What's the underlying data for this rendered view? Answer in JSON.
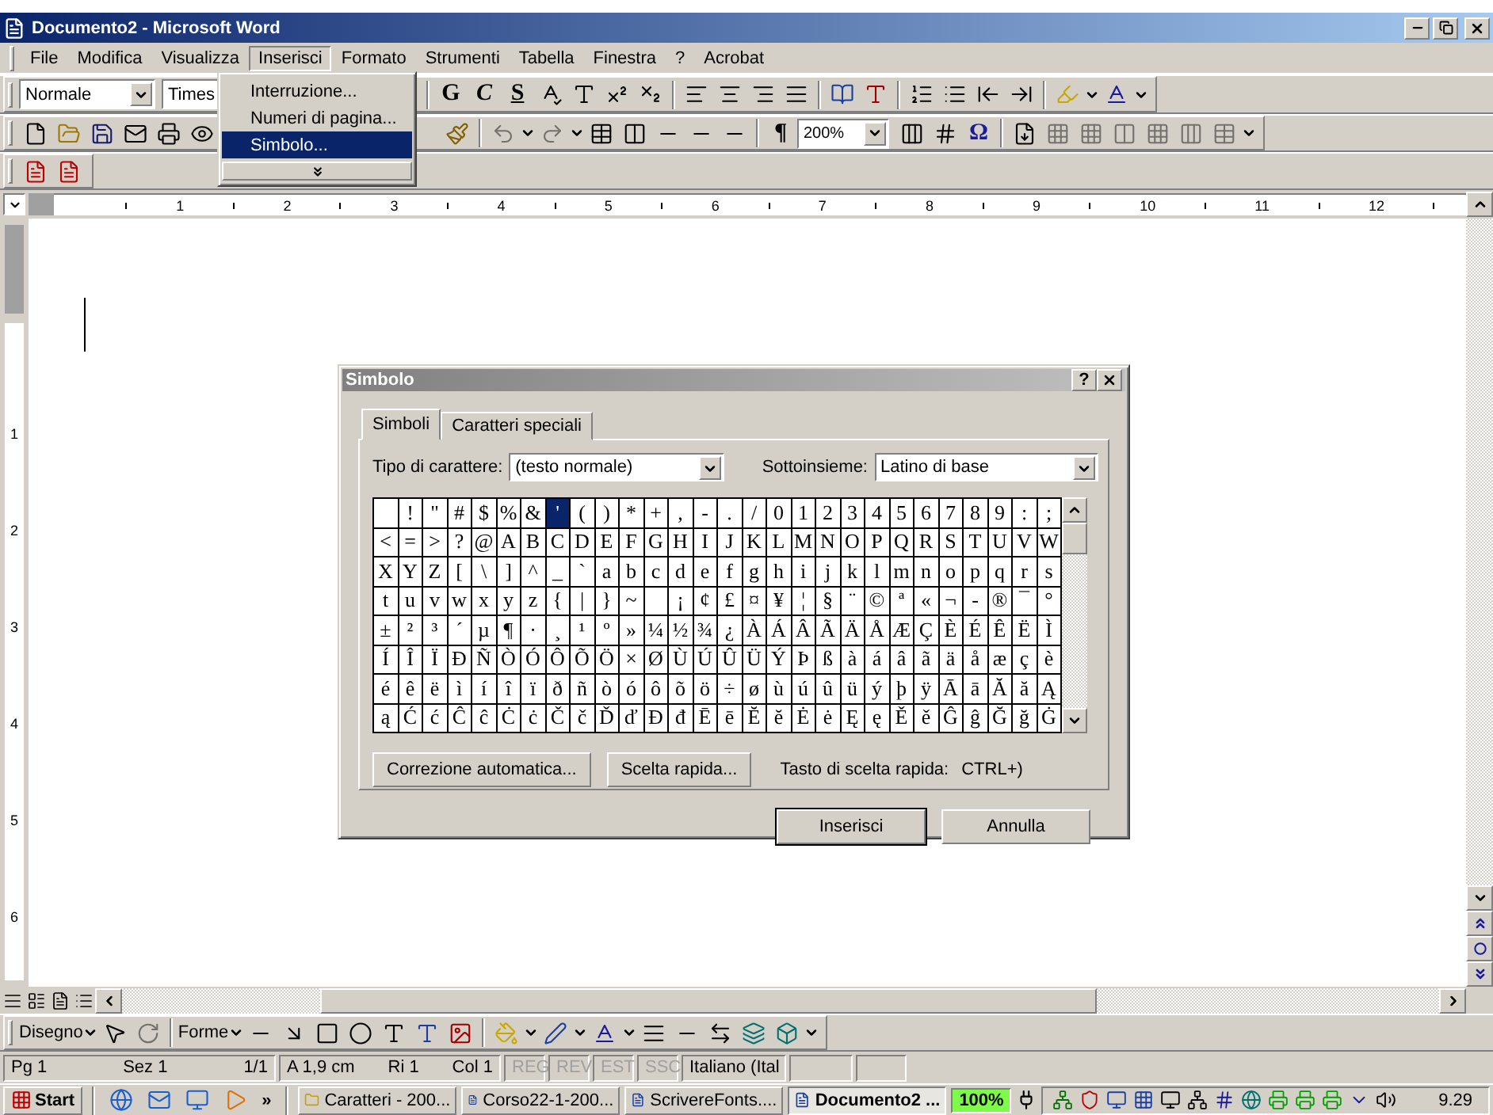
{
  "window": {
    "title": "Documento2 - Microsoft Word"
  },
  "menu": [
    {
      "label": "File",
      "selected": false
    },
    {
      "label": "Modifica",
      "selected": false
    },
    {
      "label": "Visualizza",
      "selected": false
    },
    {
      "label": "Inserisci",
      "selected": true
    },
    {
      "label": "Formato",
      "selected": false
    },
    {
      "label": "Strumenti",
      "selected": false
    },
    {
      "label": "Tabella",
      "selected": false
    },
    {
      "label": "Finestra",
      "selected": false
    },
    {
      "label": "?",
      "selected": false
    },
    {
      "label": "Acrobat",
      "selected": false
    }
  ],
  "insert_menu": {
    "items": [
      {
        "label": "Interruzione...",
        "selected": false
      },
      {
        "label": "Numeri di pagina...",
        "selected": false
      },
      {
        "label": "Simbolo...",
        "selected": true
      }
    ]
  },
  "formatting_toolbar": {
    "style": "Normale",
    "font": "Times",
    "text_buttons": [
      "G",
      "C",
      "S"
    ]
  },
  "standard_toolbar": {
    "pilcrow": "¶",
    "zoom": "200%",
    "symbol": "Ω"
  },
  "ruler": {
    "horizontal": [
      "1",
      "2",
      "3",
      "4",
      "5",
      "6",
      "7",
      "8",
      "9",
      "10",
      "11",
      "12"
    ],
    "vertical": [
      "1",
      "2",
      "3",
      "4",
      "5",
      "6"
    ]
  },
  "dialog": {
    "title": "Simbolo",
    "help": "?",
    "tabs": [
      {
        "label": "Simboli",
        "selected": true
      },
      {
        "label": "Caratteri speciali",
        "selected": false
      }
    ],
    "font_label": "Tipo di carattere:",
    "font_value": "(testo normale)",
    "subset_label": "Sottoinsieme:",
    "subset_value": "Latino di base",
    "grid": [
      [
        {
          "selected": false
        },
        {
          "char": "!",
          "selected": false
        },
        {
          "char": "\"",
          "selected": false
        },
        {
          "char": "#",
          "selected": false
        },
        {
          "char": "$",
          "selected": false
        },
        {
          "char": "%",
          "selected": false
        },
        {
          "char": "&",
          "selected": false
        },
        {
          "char": "'",
          "selected": true
        },
        {
          "char": "(",
          "selected": false
        },
        {
          "char": ")",
          "selected": false
        },
        {
          "char": "*",
          "selected": false
        },
        {
          "char": "+",
          "selected": false
        },
        {
          "char": ",",
          "selected": false
        },
        {
          "char": "-",
          "selected": false
        },
        {
          "char": ".",
          "selected": false
        },
        {
          "char": "/",
          "selected": false
        },
        {
          "char": "0",
          "selected": false
        },
        {
          "char": "1",
          "selected": false
        },
        {
          "char": "2",
          "selected": false
        },
        {
          "char": "3",
          "selected": false
        },
        {
          "char": "4",
          "selected": false
        },
        {
          "char": "5",
          "selected": false
        },
        {
          "char": "6",
          "selected": false
        },
        {
          "char": "7",
          "selected": false
        },
        {
          "char": "8",
          "selected": false
        },
        {
          "char": "9",
          "selected": false
        },
        {
          "char": ":",
          "selected": false
        },
        {
          "char": ";",
          "selected": false
        }
      ],
      [
        {
          "char": "<",
          "selected": false
        },
        {
          "char": "=",
          "selected": false
        },
        {
          "char": ">",
          "selected": false
        },
        {
          "char": "?",
          "selected": false
        },
        {
          "char": "@",
          "selected": false
        },
        {
          "char": "A",
          "selected": false
        },
        {
          "char": "B",
          "selected": false
        },
        {
          "char": "C",
          "selected": false
        },
        {
          "char": "D",
          "selected": false
        },
        {
          "char": "E",
          "selected": false
        },
        {
          "char": "F",
          "selected": false
        },
        {
          "char": "G",
          "selected": false
        },
        {
          "char": "H",
          "selected": false
        },
        {
          "char": "I",
          "selected": false
        },
        {
          "char": "J",
          "selected": false
        },
        {
          "char": "K",
          "selected": false
        },
        {
          "char": "L",
          "selected": false
        },
        {
          "char": "M",
          "selected": false
        },
        {
          "char": "N",
          "selected": false
        },
        {
          "char": "O",
          "selected": false
        },
        {
          "char": "P",
          "selected": false
        },
        {
          "char": "Q",
          "selected": false
        },
        {
          "char": "R",
          "selected": false
        },
        {
          "char": "S",
          "selected": false
        },
        {
          "char": "T",
          "selected": false
        },
        {
          "char": "U",
          "selected": false
        },
        {
          "char": "V",
          "selected": false
        },
        {
          "char": "W",
          "selected": false
        }
      ],
      [
        {
          "char": "X",
          "selected": false
        },
        {
          "char": "Y",
          "selected": false
        },
        {
          "char": "Z",
          "selected": false
        },
        {
          "char": "[",
          "selected": false
        },
        {
          "char": "\\",
          "selected": false
        },
        {
          "char": "]",
          "selected": false
        },
        {
          "char": "^",
          "selected": false
        },
        {
          "char": "_",
          "selected": false
        },
        {
          "char": "`",
          "selected": false
        },
        {
          "char": "a",
          "selected": false
        },
        {
          "char": "b",
          "selected": false
        },
        {
          "char": "c",
          "selected": false
        },
        {
          "char": "d",
          "selected": false
        },
        {
          "char": "e",
          "selected": false
        },
        {
          "char": "f",
          "selected": false
        },
        {
          "char": "g",
          "selected": false
        },
        {
          "char": "h",
          "selected": false
        },
        {
          "char": "i",
          "selected": false
        },
        {
          "char": "j",
          "selected": false
        },
        {
          "char": "k",
          "selected": false
        },
        {
          "char": "l",
          "selected": false
        },
        {
          "char": "m",
          "selected": false
        },
        {
          "char": "n",
          "selected": false
        },
        {
          "char": "o",
          "selected": false
        },
        {
          "char": "p",
          "selected": false
        },
        {
          "char": "q",
          "selected": false
        },
        {
          "char": "r",
          "selected": false
        },
        {
          "char": "s",
          "selected": false
        }
      ],
      [
        {
          "char": "t",
          "selected": false
        },
        {
          "char": "u",
          "selected": false
        },
        {
          "char": "v",
          "selected": false
        },
        {
          "char": "w",
          "selected": false
        },
        {
          "char": "x",
          "selected": false
        },
        {
          "char": "y",
          "selected": false
        },
        {
          "char": "z",
          "selected": false
        },
        {
          "char": "{",
          "selected": false
        },
        {
          "char": "|",
          "selected": false
        },
        {
          "char": "}",
          "selected": false
        },
        {
          "char": "~",
          "selected": false
        },
        {
          "selected": false
        },
        {
          "char": "¡",
          "selected": false
        },
        {
          "char": "¢",
          "selected": false
        },
        {
          "char": "£",
          "selected": false
        },
        {
          "char": "¤",
          "selected": false
        },
        {
          "char": "¥",
          "selected": false
        },
        {
          "char": "¦",
          "selected": false
        },
        {
          "char": "§",
          "selected": false
        },
        {
          "char": "¨",
          "selected": false
        },
        {
          "char": "©",
          "selected": false
        },
        {
          "char": "ª",
          "selected": false
        },
        {
          "char": "«",
          "selected": false
        },
        {
          "char": "¬",
          "selected": false
        },
        {
          "char": "-",
          "selected": false
        },
        {
          "char": "®",
          "selected": false
        },
        {
          "char": "¯",
          "selected": false
        },
        {
          "char": "°",
          "selected": false
        }
      ],
      [
        {
          "char": "±",
          "selected": false
        },
        {
          "char": "²",
          "selected": false
        },
        {
          "char": "³",
          "selected": false
        },
        {
          "char": "´",
          "selected": false
        },
        {
          "char": "µ",
          "selected": false
        },
        {
          "char": "¶",
          "selected": false
        },
        {
          "char": "·",
          "selected": false
        },
        {
          "char": "¸",
          "selected": false
        },
        {
          "char": "¹",
          "selected": false
        },
        {
          "char": "º",
          "selected": false
        },
        {
          "char": "»",
          "selected": false
        },
        {
          "char": "¼",
          "selected": false
        },
        {
          "char": "½",
          "selected": false
        },
        {
          "char": "¾",
          "selected": false
        },
        {
          "char": "¿",
          "selected": false
        },
        {
          "char": "À",
          "selected": false
        },
        {
          "char": "Á",
          "selected": false
        },
        {
          "char": "Â",
          "selected": false
        },
        {
          "char": "Ã",
          "selected": false
        },
        {
          "char": "Ä",
          "selected": false
        },
        {
          "char": "Å",
          "selected": false
        },
        {
          "char": "Æ",
          "selected": false
        },
        {
          "char": "Ç",
          "selected": false
        },
        {
          "char": "È",
          "selected": false
        },
        {
          "char": "É",
          "selected": false
        },
        {
          "char": "Ê",
          "selected": false
        },
        {
          "char": "Ë",
          "selected": false
        },
        {
          "char": "Ì",
          "selected": false
        }
      ],
      [
        {
          "char": "Í",
          "selected": false
        },
        {
          "char": "Î",
          "selected": false
        },
        {
          "char": "Ï",
          "selected": false
        },
        {
          "char": "Ð",
          "selected": false
        },
        {
          "char": "Ñ",
          "selected": false
        },
        {
          "char": "Ò",
          "selected": false
        },
        {
          "char": "Ó",
          "selected": false
        },
        {
          "char": "Ô",
          "selected": false
        },
        {
          "char": "Õ",
          "selected": false
        },
        {
          "char": "Ö",
          "selected": false
        },
        {
          "char": "×",
          "selected": false
        },
        {
          "char": "Ø",
          "selected": false
        },
        {
          "char": "Ù",
          "selected": false
        },
        {
          "char": "Ú",
          "selected": false
        },
        {
          "char": "Û",
          "selected": false
        },
        {
          "char": "Ü",
          "selected": false
        },
        {
          "char": "Ý",
          "selected": false
        },
        {
          "char": "Þ",
          "selected": false
        },
        {
          "char": "ß",
          "selected": false
        },
        {
          "char": "à",
          "selected": false
        },
        {
          "char": "á",
          "selected": false
        },
        {
          "char": "â",
          "selected": false
        },
        {
          "char": "ã",
          "selected": false
        },
        {
          "char": "ä",
          "selected": false
        },
        {
          "char": "å",
          "selected": false
        },
        {
          "char": "æ",
          "selected": false
        },
        {
          "char": "ç",
          "selected": false
        },
        {
          "char": "è",
          "selected": false
        }
      ],
      [
        {
          "char": "é",
          "selected": false
        },
        {
          "char": "ê",
          "selected": false
        },
        {
          "char": "ë",
          "selected": false
        },
        {
          "char": "ì",
          "selected": false
        },
        {
          "char": "í",
          "selected": false
        },
        {
          "char": "î",
          "selected": false
        },
        {
          "char": "ï",
          "selected": false
        },
        {
          "char": "ð",
          "selected": false
        },
        {
          "char": "ñ",
          "selected": false
        },
        {
          "char": "ò",
          "selected": false
        },
        {
          "char": "ó",
          "selected": false
        },
        {
          "char": "ô",
          "selected": false
        },
        {
          "char": "õ",
          "selected": false
        },
        {
          "char": "ö",
          "selected": false
        },
        {
          "char": "÷",
          "selected": false
        },
        {
          "char": "ø",
          "selected": false
        },
        {
          "char": "ù",
          "selected": false
        },
        {
          "char": "ú",
          "selected": false
        },
        {
          "char": "û",
          "selected": false
        },
        {
          "char": "ü",
          "selected": false
        },
        {
          "char": "ý",
          "selected": false
        },
        {
          "char": "þ",
          "selected": false
        },
        {
          "char": "ÿ",
          "selected": false
        },
        {
          "char": "Ā",
          "selected": false
        },
        {
          "char": "ā",
          "selected": false
        },
        {
          "char": "Ă",
          "selected": false
        },
        {
          "char": "ă",
          "selected": false
        },
        {
          "char": "Ą",
          "selected": false
        }
      ],
      [
        {
          "char": "ą",
          "selected": false
        },
        {
          "char": "Ć",
          "selected": false
        },
        {
          "char": "ć",
          "selected": false
        },
        {
          "char": "Ĉ",
          "selected": false
        },
        {
          "char": "ĉ",
          "selected": false
        },
        {
          "char": "Ċ",
          "selected": false
        },
        {
          "char": "ċ",
          "selected": false
        },
        {
          "char": "Č",
          "selected": false
        },
        {
          "char": "č",
          "selected": false
        },
        {
          "char": "Ď",
          "selected": false
        },
        {
          "char": "ď",
          "selected": false
        },
        {
          "char": "Đ",
          "selected": false
        },
        {
          "char": "đ",
          "selected": false
        },
        {
          "char": "Ē",
          "selected": false
        },
        {
          "char": "ē",
          "selected": false
        },
        {
          "char": "Ĕ",
          "selected": false
        },
        {
          "char": "ĕ",
          "selected": false
        },
        {
          "char": "Ė",
          "selected": false
        },
        {
          "char": "ė",
          "selected": false
        },
        {
          "char": "Ę",
          "selected": false
        },
        {
          "char": "ę",
          "selected": false
        },
        {
          "char": "Ě",
          "selected": false
        },
        {
          "char": "ě",
          "selected": false
        },
        {
          "char": "Ĝ",
          "selected": false
        },
        {
          "char": "ĝ",
          "selected": false
        },
        {
          "char": "Ğ",
          "selected": false
        },
        {
          "char": "ğ",
          "selected": false
        },
        {
          "char": "Ġ",
          "selected": false
        }
      ]
    ],
    "tool_buttons": [
      "Correzione automatica...",
      "Scelta rapida..."
    ],
    "shortcut_label": "Tasto di scelta rapida:",
    "shortcut": "CTRL+)",
    "actions": [
      {
        "label": "Inserisci",
        "default": true
      },
      {
        "label": "Annulla",
        "default": false
      }
    ]
  },
  "drawing_toolbar": {
    "draw": "Disegno",
    "shapes": "Forme"
  },
  "status_bar": {
    "panels": [
      {
        "items": [
          "Pg 1",
          "Sez 1",
          "1/1"
        ]
      },
      {
        "items": [
          "A 1,9 cm",
          "Ri 1",
          "Col 1"
        ]
      }
    ],
    "modes": [
      {
        "label": "REG",
        "disabled": true
      },
      {
        "label": "REV",
        "disabled": true
      },
      {
        "label": "EST",
        "disabled": true
      },
      {
        "label": "SSC",
        "disabled": true
      }
    ],
    "language": "Italiano (Ital"
  },
  "taskbar": {
    "start": "Start",
    "more": "»",
    "tasks": [
      {
        "label": "Caratteri - 200...",
        "kind": "folder",
        "selected": false
      },
      {
        "label": "Corso22-1-200...",
        "kind": "document",
        "selected": false
      },
      {
        "label": "ScrivereFonts....",
        "kind": "document",
        "selected": false
      },
      {
        "label": "Documento2 ...",
        "kind": "document",
        "selected": true
      }
    ],
    "zoom_badge": "100%",
    "clock": "9.29"
  }
}
